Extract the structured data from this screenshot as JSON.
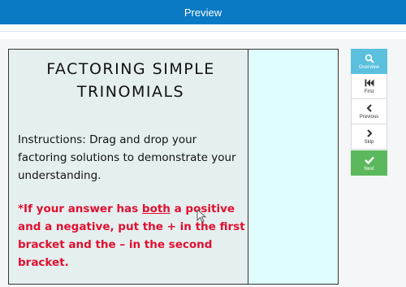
{
  "header": {
    "title": "Preview"
  },
  "slide": {
    "title_line1": "FACTORING SIMPLE",
    "title_line2": "TRINOMIALS",
    "instructions": "Instructions: Drag and drop your factoring solutions to demonstrate your understanding.",
    "note_prefix": "*If your answer has ",
    "note_emphasis": "both",
    "note_suffix": " a positive and a negative, put the + in the first bracket and the – in the second bracket."
  },
  "colors": {
    "header_bg": "#0a7ac6",
    "note_red": "#e0102f",
    "dropzone_bg": "#dffdfd",
    "overview_bg": "#5bc0de",
    "next_bg": "#5cb85c"
  },
  "nav": {
    "overview": {
      "label": "Overview",
      "icon": "search-icon"
    },
    "first": {
      "label": "First",
      "icon": "skip-to-first-icon"
    },
    "previous": {
      "label": "Previous",
      "icon": "chevron-left-icon"
    },
    "skip": {
      "label": "Skip",
      "icon": "chevron-right-icon"
    },
    "next": {
      "label": "Next",
      "icon": "check-icon"
    }
  }
}
